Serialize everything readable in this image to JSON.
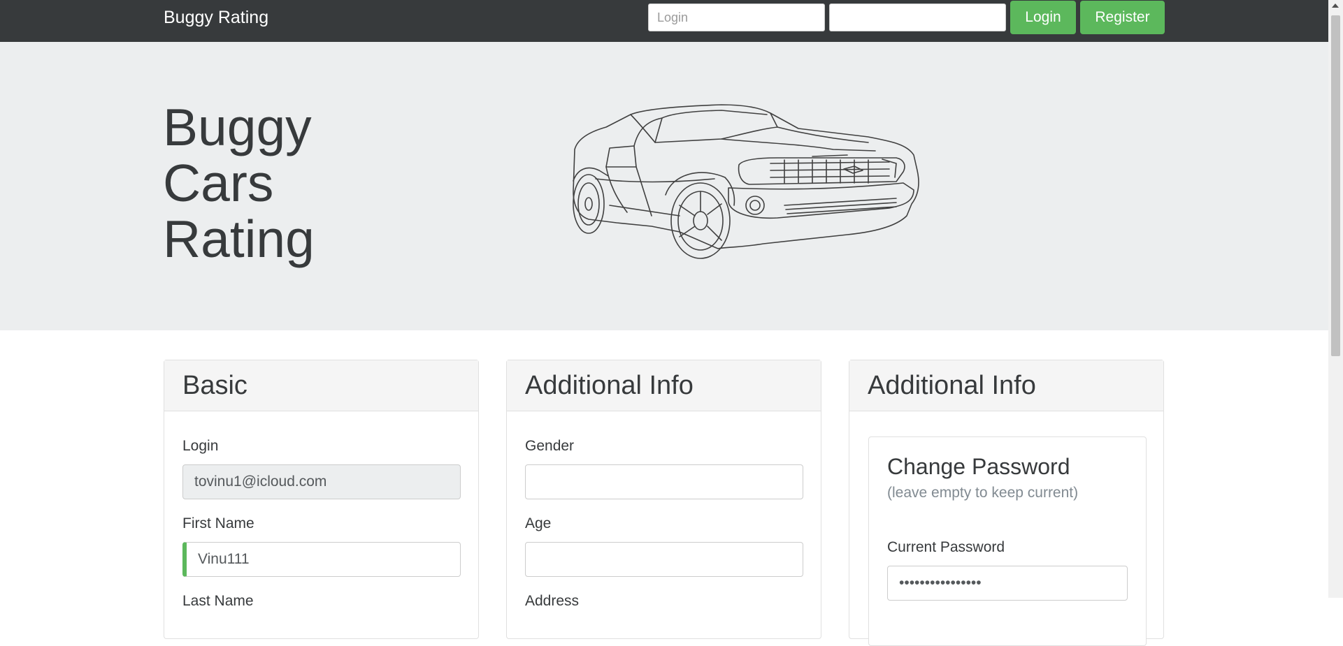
{
  "nav": {
    "brand": "Buggy Rating",
    "login_placeholder": "Login",
    "password_placeholder": "",
    "login_button": "Login",
    "register_button": "Register"
  },
  "hero": {
    "title_line1": "Buggy",
    "title_line2": "Cars",
    "title_line3": "Rating",
    "image": "car-sketch-icon"
  },
  "cards": {
    "basic": {
      "title": "Basic",
      "login_label": "Login",
      "login_value": "tovinu1@icloud.com",
      "first_name_label": "First Name",
      "first_name_value": "Vinu111",
      "last_name_label": "Last Name"
    },
    "additional": {
      "title": "Additional Info",
      "gender_label": "Gender",
      "gender_value": "",
      "age_label": "Age",
      "age_value": "",
      "address_label": "Address"
    },
    "password": {
      "title": "Additional Info",
      "inner_title": "Change Password",
      "inner_subtitle": "(leave empty to keep current)",
      "current_password_label": "Current Password",
      "current_password_value": "••••••••••••••••"
    }
  },
  "colors": {
    "navbar": "#373a3c",
    "hero": "#eceeef",
    "success": "#5cb85c"
  }
}
